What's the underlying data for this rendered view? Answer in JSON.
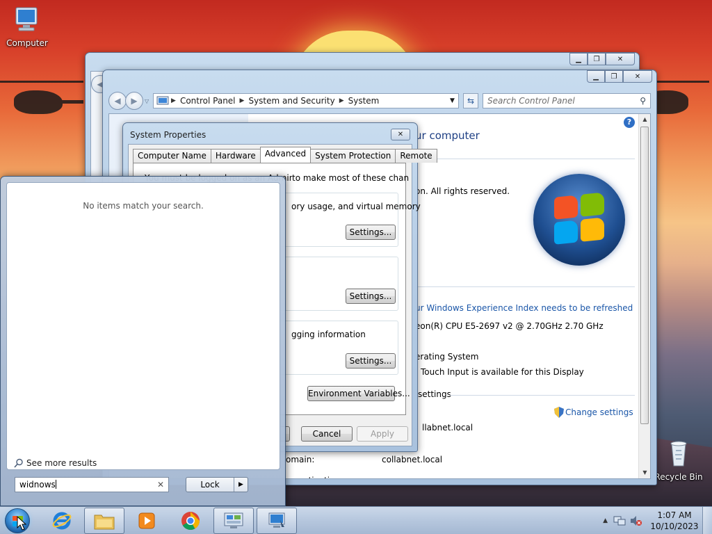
{
  "desktop": {
    "icons": [
      {
        "label": "Computer"
      },
      {
        "label": "Recycle Bin"
      }
    ]
  },
  "back_window": {
    "caption_buttons": [
      "minimize",
      "maximize",
      "close"
    ]
  },
  "system_window": {
    "address_crumbs": [
      "Control Panel",
      "System and Security",
      "System"
    ],
    "search_placeholder": "Search Control Panel",
    "heading_fragment": "ur computer",
    "copyright_fragment": "on.  All rights reserved.",
    "experience_link": "ur Windows Experience Index needs to be refreshed",
    "processor_fragment": "eon(R) CPU E5-2697 v2 @ 2.70GHz   2.70 GHz",
    "os_type_fragment": "erating System",
    "pen_touch_fragment": "Touch Input is available for this Display",
    "settings_fragment": "settings",
    "change_settings": "Change settings",
    "domain_fragment_1": "llabnet.local",
    "domain_label": "omain:",
    "domain_value": "collabnet.local",
    "activation_fragment": "ctivation"
  },
  "system_properties": {
    "title": "System Properties",
    "tabs": [
      "Computer Name",
      "Hardware",
      "Advanced",
      "System Protection",
      "Remote"
    ],
    "active_tab": "Advanced",
    "admin_note_fragment": "to make most of these changes.",
    "admin_note_left": "You must be logged on as an Administrator",
    "performance_fragment": "ory usage, and virtual memory",
    "startup_fragment": "gging information",
    "settings_label": "Settings...",
    "env_vars": "Environment Variables...",
    "cancel": "Cancel",
    "apply": "Apply"
  },
  "start_menu": {
    "empty_message": "No items match your search.",
    "see_more": "See more results",
    "search_value": "widnows",
    "lock_label": "Lock"
  },
  "taskbar": {
    "time": "1:07 AM",
    "date": "10/10/2023"
  },
  "colors": {
    "link": "#1a56a8",
    "heading": "#1e3f84",
    "windows_flag": [
      "#f35325",
      "#81bc06",
      "#05a6f0",
      "#ffba08"
    ]
  }
}
